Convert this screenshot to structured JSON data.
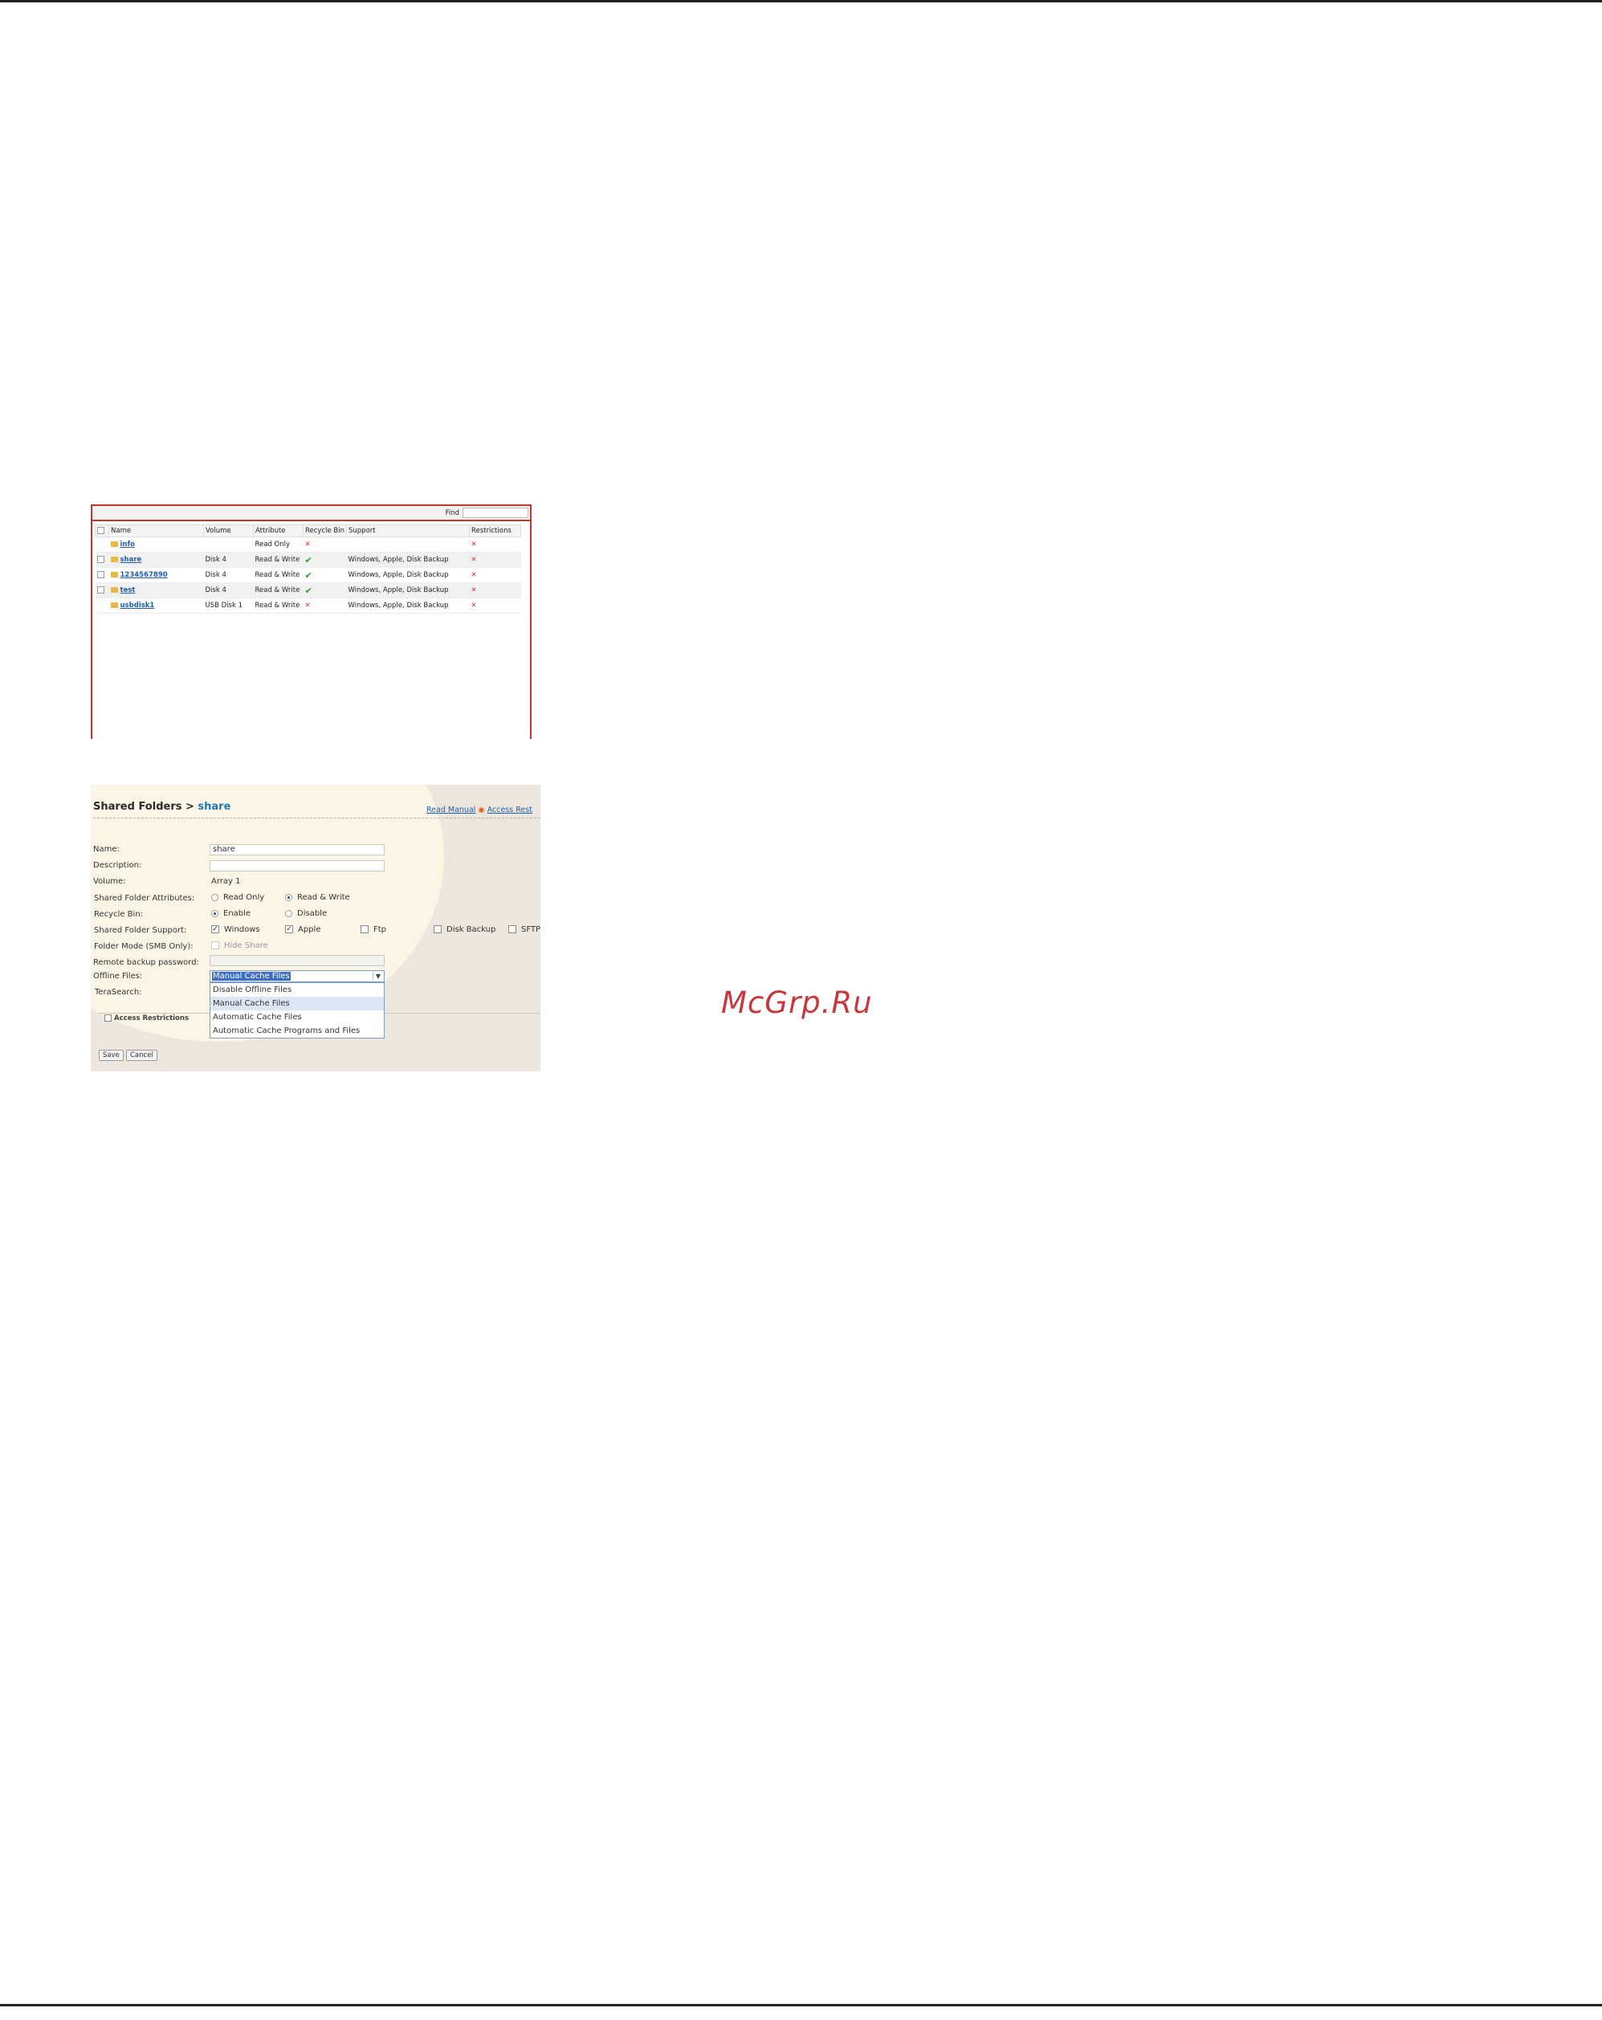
{
  "list": {
    "find_label": "Find",
    "find_value": "",
    "columns": [
      "",
      "Name",
      "Volume",
      "Attribute",
      "Recycle Bin",
      "Support",
      "Restrictions"
    ],
    "rows": [
      {
        "name": "info",
        "volume": "",
        "attribute": "Read Only",
        "recycle": "x",
        "support": "",
        "restriction": "x",
        "has_checkbox": false
      },
      {
        "name": "share",
        "volume": "Disk 4",
        "attribute": "Read & Write",
        "recycle": "check",
        "support": "Windows, Apple, Disk Backup",
        "restriction": "x",
        "has_checkbox": true
      },
      {
        "name": "1234567890",
        "volume": "Disk 4",
        "attribute": "Read & Write",
        "recycle": "check",
        "support": "Windows, Apple, Disk Backup",
        "restriction": "x",
        "has_checkbox": true
      },
      {
        "name": "test",
        "volume": "Disk 4",
        "attribute": "Read & Write",
        "recycle": "check",
        "support": "Windows, Apple, Disk Backup",
        "restriction": "x",
        "has_checkbox": true
      },
      {
        "name": "usbdisk1",
        "volume": "USB Disk 1",
        "attribute": "Read & Write",
        "recycle": "x",
        "support": "Windows, Apple, Disk Backup",
        "restriction": "x",
        "has_checkbox": false
      }
    ],
    "icons": {
      "folder": "folder-icon",
      "cross": "cross-icon",
      "check": "check-icon"
    },
    "colors": {
      "frame": "#c0392b",
      "link": "#1f5fa8",
      "cross": "#e03030",
      "check": "#2a9a2a"
    }
  },
  "form": {
    "breadcrumb_parent": "Shared Folders >",
    "breadcrumb_current": "share",
    "read_manual": "Read Manual",
    "access_restrictions_link": "Access Rest",
    "labels": {
      "name": "Name:",
      "description": "Description:",
      "volume": "Volume:",
      "attributes": "Shared Folder Attributes:",
      "recycle_bin": "Recycle Bin:",
      "support": "Shared Folder Support:",
      "folder_mode": "Folder Mode (SMB Only):",
      "remote_backup_password": "Remote backup password:",
      "offline_files": "Offline Files:",
      "terasearch": "TeraSearch:"
    },
    "values": {
      "name": "share",
      "description": "",
      "volume": "Array 1",
      "remote_backup_password": ""
    },
    "attributes_options": {
      "read_only": "Read Only",
      "read_write": "Read & Write"
    },
    "recycle_options": {
      "enable": "Enable",
      "disable": "Disable"
    },
    "support_options": {
      "windows": "Windows",
      "apple": "Apple",
      "ftp": "Ftp",
      "disk_backup": "Disk Backup",
      "sftp": "SFTP"
    },
    "hide_share": "Hide Share",
    "offline_files": {
      "selected": "Manual Cache Files",
      "options": [
        "Disable Offline Files",
        "Manual Cache Files",
        "Automatic Cache Files",
        "Automatic Cache Programs and Files"
      ]
    },
    "access_restrictions_checkbox": "Access Restrictions",
    "save_button": "Save",
    "cancel_button": "Cancel"
  },
  "watermark": "McGrp.Ru"
}
